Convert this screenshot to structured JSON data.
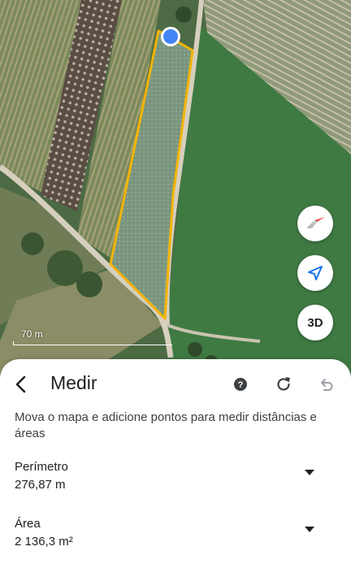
{
  "map": {
    "scale_label": "70 m",
    "buttons": {
      "compass_icon": "compass-icon",
      "locate_icon": "navigation-arrow-icon",
      "three_d_label": "3D"
    },
    "measure_outline_color": "#f4b400",
    "point_marker_color": "#4285f4"
  },
  "sheet": {
    "title": "Medir",
    "back_icon": "chevron-left-icon",
    "help_icon": "help-icon",
    "refresh_icon": "refresh-icon",
    "undo_icon": "undo-icon",
    "instructions": "Mova o mapa e adicione pontos para medir distâncias e áreas",
    "perimeter": {
      "label": "Perímetro",
      "value": "276,87 m"
    },
    "area": {
      "label": "Área",
      "value": "2 136,3 m²"
    }
  }
}
